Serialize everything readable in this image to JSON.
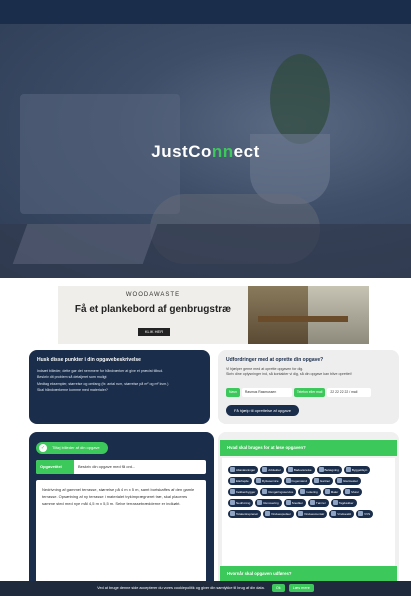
{
  "hero": {
    "logo_pre": "JustCo",
    "logo_accent": "nn",
    "logo_post": "ect"
  },
  "ad": {
    "brand": "WOODAWASTE",
    "headline": "Få et plankebord af genbrugstræ",
    "cta": "KLIK HER"
  },
  "tips": {
    "title": "Husk disse punkter i din opgavebeskrivelse",
    "lines": [
      "Indsæt billeder, dette gør det nemmere for håndværker at give et præcist tilbud.",
      "Beskriv dit problem så detaljeret som muligt",
      "Medtag eksempler, størrelse og omfang (fx: antal rum, størrelse på m² og m² kvm.)",
      "Skal håndværkerne komme med materialer?"
    ]
  },
  "help": {
    "title": "Udfordringer med at oprette din opgave?",
    "line1": "Vi hjælper gerne med at oprette opgaven for dig.",
    "line2": "Skriv dine oplysninger ind, så kontakter vi dig, så din opgave kan blive oprettet!",
    "name_label": "Navn",
    "name_value": "Rasmus Rasmussen",
    "phone_label": "Telefon eller mail",
    "phone_value": "22 22 22 22 / mail",
    "button": "Få hjælp til oprettelse af opgave"
  },
  "form": {
    "images_tag": "Tilføj billeder af din opgave",
    "subject_label": "Opgavetitel",
    "subject_placeholder": "Beskriv din opgave med få ord...",
    "description": "Nedrivning af gammel terrasse, størrelse på 4 m x 5 m, samt bortskaffes af den gamle terrasse. Opsætning af ny terrasse i materialet trykimprægneret træ, skal placeres samme sted med nye mål 4,5 m x 5,5 m. Selve terrassebrædderne er indkøbt."
  },
  "categories": {
    "title": "Hvad skal bruges for at løse opgaven?",
    "items": [
      "Altanløsninger",
      "Arkitekter",
      "Badeværelse",
      "Belægning",
      "Byggetilsyn",
      "Elarbejde",
      "Flytteservice",
      "Fugemænd",
      "Gartner",
      "Glarmester",
      "Køkkenbygger",
      "Rengøringsservice",
      "Isolering",
      "Maler",
      "Murer",
      "Nedrivning",
      "Renovering",
      "Snedker",
      "Tømrer",
      "Tagdækker",
      "Totalentreprenør",
      "Vinduespudser",
      "Vinduesmontør",
      "Vindueskit",
      "VVS"
    ],
    "title2": "Hvornår skal opgaven udføres?"
  },
  "cookie": {
    "text": "Ved at bruge denne side accepterer du vores cookiepolitik og giver din samtykke til brug af din data.",
    "ok": "Ok",
    "more": "Læs mere"
  }
}
